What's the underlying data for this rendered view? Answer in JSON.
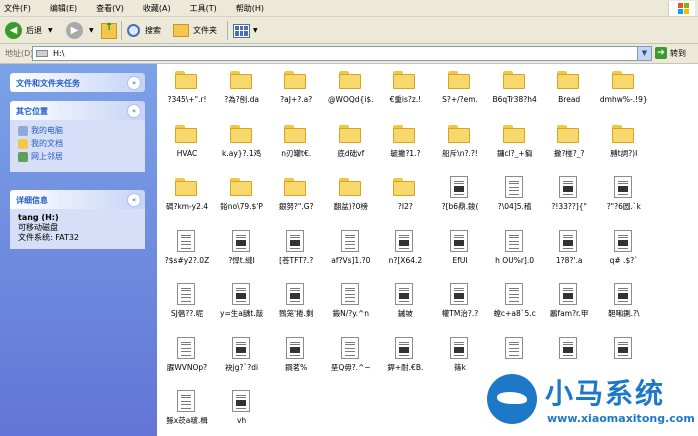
{
  "menu": [
    "文件(F)",
    "编辑(E)",
    "查看(V)",
    "收藏(A)",
    "工具(T)",
    "帮助(H)"
  ],
  "toolbar": {
    "back_label": "后退",
    "search_label": "搜索",
    "folders_label": "文件夹"
  },
  "address": {
    "label": "地址(D)",
    "value": "H:\\",
    "go_label": "转到"
  },
  "left": {
    "tasks_title": "文件和文件夹任务",
    "places_title": "其它位置",
    "places": [
      "我的电脑",
      "我的文档",
      "网上邻居"
    ],
    "details_title": "详细信息",
    "drive_name": "tang (H:)",
    "drive_type": "可移动磁盘",
    "fs": "文件系统: FAT32"
  },
  "items": [
    {
      "type": "folder",
      "label": "?345\\+\".r!"
    },
    {
      "type": "folder",
      "label": "?為?刨.da"
    },
    {
      "type": "folder",
      "label": "?aJ+?.a?"
    },
    {
      "type": "folder",
      "label": "@WOQd{i$."
    },
    {
      "type": "folder",
      "label": "€重is?z.!"
    },
    {
      "type": "folder",
      "label": "S?+/?em."
    },
    {
      "type": "folder",
      "label": "B6qTr38?h4"
    },
    {
      "type": "folder",
      "label": "Bread"
    },
    {
      "type": "folder",
      "label": "dmhw%-.!9}"
    },
    {
      "type": "folder",
      "label": "HVAC"
    },
    {
      "type": "folder",
      "label": "k.ay}?.1鸡"
    },
    {
      "type": "folder",
      "label": "n刃罐t€."
    },
    {
      "type": "folder",
      "label": "底d础vf"
    },
    {
      "type": "folder",
      "label": "毓撇?1.?"
    },
    {
      "type": "folder",
      "label": "船斥\\n?.?!"
    },
    {
      "type": "folder",
      "label": "鏞cl?_+匔"
    },
    {
      "type": "folder",
      "label": "撒?椪?_?"
    },
    {
      "type": "folder",
      "label": "膊t詞?)I"
    },
    {
      "type": "folder",
      "label": "碉?km-y2.4"
    },
    {
      "type": "folder",
      "label": "鋊no\\79.$'P"
    },
    {
      "type": "folder",
      "label": "銀努?\".G?"
    },
    {
      "type": "folder",
      "label": "翻盆)?0榜"
    },
    {
      "type": "folder",
      "label": "?I2?"
    },
    {
      "type": "file",
      "label": "?[b6鼎.鋑("
    },
    {
      "type": "file",
      "label": "?\\04]5.稽"
    },
    {
      "type": "file",
      "label": "?!33??]{\""
    },
    {
      "type": "file",
      "label": "?\"?6圆.`k"
    },
    {
      "type": "file",
      "label": "?$s#y2?.0Z"
    },
    {
      "type": "file",
      "label": "?悍t.縫I"
    },
    {
      "type": "file",
      "label": "[苍TFT?.?"
    },
    {
      "type": "file",
      "label": "af?Vs]1.?0"
    },
    {
      "type": "file",
      "label": "n?[X64.2"
    },
    {
      "type": "file",
      "label": "EfUI"
    },
    {
      "type": "file",
      "label": "h OU%r].0"
    },
    {
      "type": "file",
      "label": "1?8?'.a"
    },
    {
      "type": "file",
      "label": "q# .$?`"
    },
    {
      "type": "file",
      "label": "SJ倡??.呢"
    },
    {
      "type": "file",
      "label": "y=生a龋t.敲"
    },
    {
      "type": "file",
      "label": "鷚笼'捲.剩"
    },
    {
      "type": "file",
      "label": "鍛N/?y.^n"
    },
    {
      "type": "file",
      "label": "鏚坡"
    },
    {
      "type": "file",
      "label": "權TM治?.?"
    },
    {
      "type": "file",
      "label": "螳c+a8`5.c"
    },
    {
      "type": "file",
      "label": "鷵fam?r.甲"
    },
    {
      "type": "file",
      "label": "靼啝鍘.?\\"
    },
    {
      "type": "file",
      "label": "脲WVNOp?"
    },
    {
      "type": "file",
      "label": "袂jg?`?di"
    },
    {
      "type": "file",
      "label": "鋼茗%"
    },
    {
      "type": "file",
      "label": "垩Q毋?.^~"
    },
    {
      "type": "file",
      "label": "銲+耐.€B."
    },
    {
      "type": "file",
      "label": "篠k"
    },
    {
      "type": "file",
      "label": ""
    },
    {
      "type": "file",
      "label": ""
    },
    {
      "type": "file",
      "label": ""
    },
    {
      "type": "file",
      "label": "鲧x莰a啵.楫"
    },
    {
      "type": "file",
      "label": "vh"
    }
  ],
  "watermark": {
    "brand": "小马系统",
    "url": "www.xiaomaxitong.com"
  }
}
